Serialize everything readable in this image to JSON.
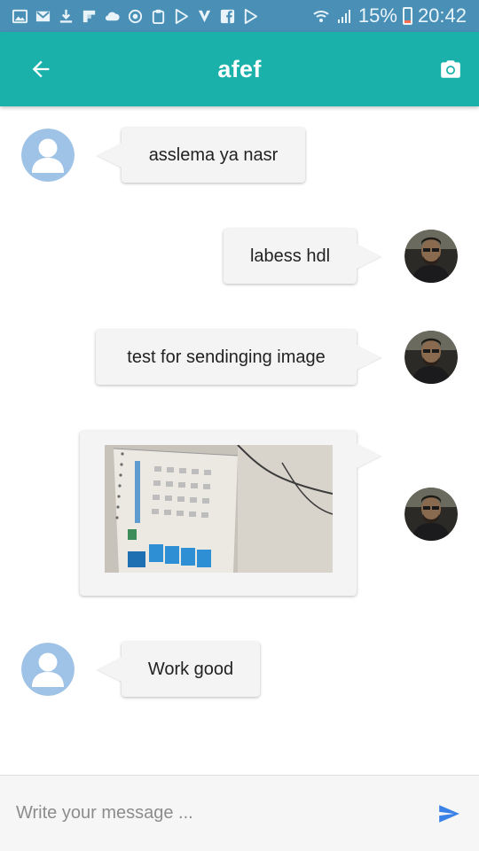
{
  "status_bar": {
    "icons": [
      "gallery-icon",
      "gmail-icon",
      "download-icon",
      "flipboard-icon",
      "cloud-icon",
      "sync-icon",
      "clipboard-icon",
      "play-store-icon",
      "vlc-icon",
      "facebook-icon",
      "play-store-icon"
    ],
    "battery_percent": "15%",
    "time": "20:42"
  },
  "app_bar": {
    "title": "afef",
    "back_icon": "arrow-left-icon",
    "action_icon": "camera-icon",
    "color": "#1bb1ab"
  },
  "messages": [
    {
      "side": "received",
      "type": "text",
      "text": "asslema ya nasr",
      "avatar": "default-user-avatar"
    },
    {
      "side": "sent",
      "type": "text",
      "text": "labess hdl",
      "avatar": "profile-photo-avatar"
    },
    {
      "side": "sent",
      "type": "text",
      "text": "test for sendinging image",
      "avatar": "profile-photo-avatar"
    },
    {
      "side": "sent",
      "type": "image",
      "image": "calendar-photo",
      "avatar": "profile-photo-avatar"
    },
    {
      "side": "received",
      "type": "text",
      "text": "Work good",
      "avatar": "default-user-avatar"
    }
  ],
  "composer": {
    "placeholder": "Write your message ...",
    "send_icon": "send-icon",
    "send_color": "#3b82e8"
  }
}
